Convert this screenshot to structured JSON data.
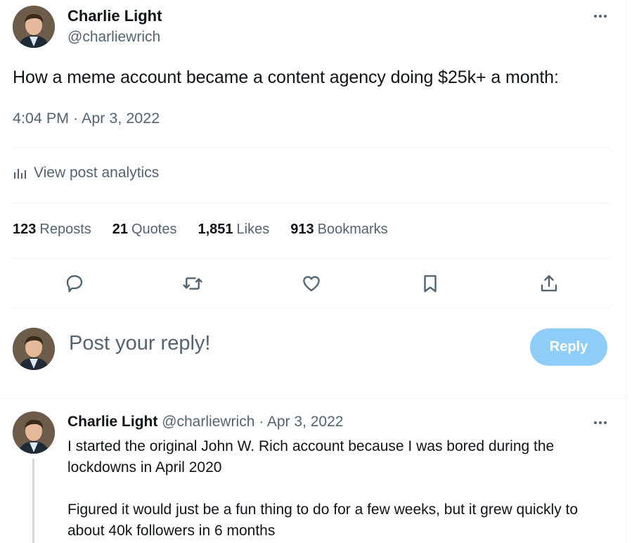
{
  "tweet": {
    "author_name": "Charlie Light",
    "author_handle": "@charliewrich",
    "text": "How a meme account became a content agency doing $25k+ a month:",
    "timestamp": "4:04 PM · Apr 3, 2022",
    "analytics_label": "View post analytics",
    "stats": [
      {
        "count": "123",
        "label": "Reposts"
      },
      {
        "count": "21",
        "label": "Quotes"
      },
      {
        "count": "1,851",
        "label": "Likes"
      },
      {
        "count": "913",
        "label": "Bookmarks"
      }
    ],
    "actions": [
      "reply-icon",
      "repost-icon",
      "like-icon",
      "bookmark-icon",
      "share-icon"
    ]
  },
  "composer": {
    "placeholder": "Post your reply!",
    "button_label": "Reply"
  },
  "reply": {
    "author_name": "Charlie Light",
    "meta": "@charliewrich · Apr 3, 2022",
    "paragraphs": [
      "I started the original John W. Rich account because I was bored during the lockdowns in April 2020",
      "Figured it would just be a fun thing to do for a few weeks, but it grew quickly to about 40k followers in 6 months"
    ]
  },
  "colors": {
    "text_primary": "#0f1419",
    "text_secondary": "#536471",
    "reply_button_disabled": "#8ecdf7",
    "divider": "#eff3f4"
  }
}
